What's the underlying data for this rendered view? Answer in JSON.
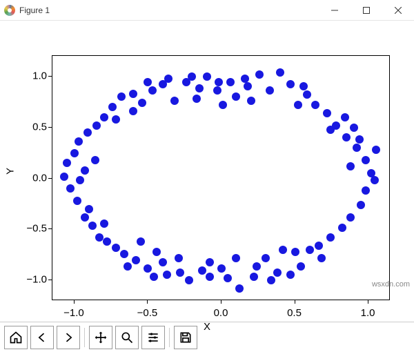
{
  "window": {
    "title": "Figure 1"
  },
  "chart_data": {
    "type": "scatter",
    "xlabel": "X",
    "ylabel": "Y",
    "xlim": [
      -1.15,
      1.15
    ],
    "ylim": [
      -1.2,
      1.2
    ],
    "xticks": [
      -1.0,
      -0.5,
      0.0,
      0.5,
      1.0
    ],
    "yticks": [
      -1.0,
      -0.5,
      0.0,
      0.5,
      1.0
    ],
    "points": [
      [
        -1.07,
        0.02
      ],
      [
        -1.05,
        0.15
      ],
      [
        -1.03,
        -0.1
      ],
      [
        -1.0,
        0.25
      ],
      [
        -0.98,
        -0.22
      ],
      [
        -0.97,
        0.36
      ],
      [
        -0.93,
        -0.38
      ],
      [
        -0.91,
        0.45
      ],
      [
        -0.88,
        -0.46
      ],
      [
        -0.85,
        0.52
      ],
      [
        -0.83,
        -0.58
      ],
      [
        -0.8,
        0.6
      ],
      [
        -0.78,
        -0.62
      ],
      [
        -0.74,
        0.7
      ],
      [
        -0.72,
        -0.68
      ],
      [
        -0.68,
        0.8
      ],
      [
        -0.66,
        -0.74
      ],
      [
        -0.6,
        0.83
      ],
      [
        -0.58,
        -0.8
      ],
      [
        -0.54,
        0.74
      ],
      [
        -0.5,
        -0.88
      ],
      [
        -0.47,
        0.86
      ],
      [
        -0.44,
        -0.72
      ],
      [
        -0.4,
        0.92
      ],
      [
        -0.37,
        -0.94
      ],
      [
        -0.32,
        0.76
      ],
      [
        -0.29,
        -0.78
      ],
      [
        -0.24,
        0.94
      ],
      [
        -0.22,
        -1.0
      ],
      [
        -0.17,
        0.78
      ],
      [
        -0.13,
        -0.9
      ],
      [
        -0.1,
        1.0
      ],
      [
        -0.08,
        -0.82
      ],
      [
        -0.03,
        0.86
      ],
      [
        0.01,
        0.72
      ],
      [
        0.04,
        -0.98
      ],
      [
        0.06,
        0.94
      ],
      [
        0.1,
        -0.78
      ],
      [
        0.12,
        -1.08
      ],
      [
        0.16,
        0.98
      ],
      [
        0.2,
        0.76
      ],
      [
        0.22,
        -0.96
      ],
      [
        0.26,
        1.02
      ],
      [
        0.3,
        -0.78
      ],
      [
        0.33,
        0.86
      ],
      [
        0.38,
        -0.92
      ],
      [
        0.4,
        1.04
      ],
      [
        0.42,
        -0.7
      ],
      [
        0.47,
        0.92
      ],
      [
        0.52,
        0.72
      ],
      [
        0.54,
        -0.86
      ],
      [
        0.58,
        0.82
      ],
      [
        0.6,
        -0.7
      ],
      [
        0.64,
        0.72
      ],
      [
        0.68,
        -0.78
      ],
      [
        0.72,
        0.64
      ],
      [
        0.74,
        -0.58
      ],
      [
        0.78,
        0.52
      ],
      [
        0.82,
        -0.48
      ],
      [
        0.85,
        0.4
      ],
      [
        0.88,
        -0.38
      ],
      [
        0.9,
        0.5
      ],
      [
        0.92,
        0.3
      ],
      [
        0.95,
        -0.26
      ],
      [
        0.98,
        0.18
      ],
      [
        0.98,
        -0.12
      ],
      [
        1.02,
        0.05
      ],
      [
        1.04,
        -0.02
      ],
      [
        1.05,
        0.28
      ],
      [
        -0.93,
        0.08
      ],
      [
        -0.96,
        -0.02
      ],
      [
        -0.28,
        -0.92
      ],
      [
        -0.55,
        -0.62
      ],
      [
        -0.15,
        0.88
      ],
      [
        -0.4,
        -0.82
      ],
      [
        0.47,
        -0.94
      ],
      [
        0.34,
        -1.0
      ],
      [
        0.0,
        -0.88
      ],
      [
        -0.08,
        -0.96
      ],
      [
        -0.6,
        0.66
      ],
      [
        -0.72,
        0.58
      ],
      [
        -0.36,
        0.98
      ],
      [
        0.66,
        -0.66
      ],
      [
        0.5,
        -0.72
      ],
      [
        -0.5,
        0.94
      ],
      [
        -0.2,
        1.0
      ],
      [
        0.84,
        0.6
      ],
      [
        0.94,
        0.38
      ],
      [
        -0.86,
        0.18
      ],
      [
        -0.8,
        -0.44
      ],
      [
        0.1,
        0.8
      ],
      [
        0.88,
        0.12
      ],
      [
        -0.64,
        -0.86
      ],
      [
        -0.02,
        0.94
      ],
      [
        0.74,
        0.48
      ],
      [
        -0.46,
        -0.96
      ],
      [
        0.24,
        -0.86
      ],
      [
        0.18,
        0.9
      ],
      [
        -0.9,
        -0.3
      ],
      [
        0.56,
        0.9
      ]
    ]
  },
  "watermark": "wsxdn.com",
  "toolbar": {
    "home": "home-icon",
    "back": "back-icon",
    "forward": "forward-icon",
    "pan": "pan-icon",
    "zoom": "zoom-icon",
    "configure": "configure-icon",
    "save": "save-icon"
  }
}
